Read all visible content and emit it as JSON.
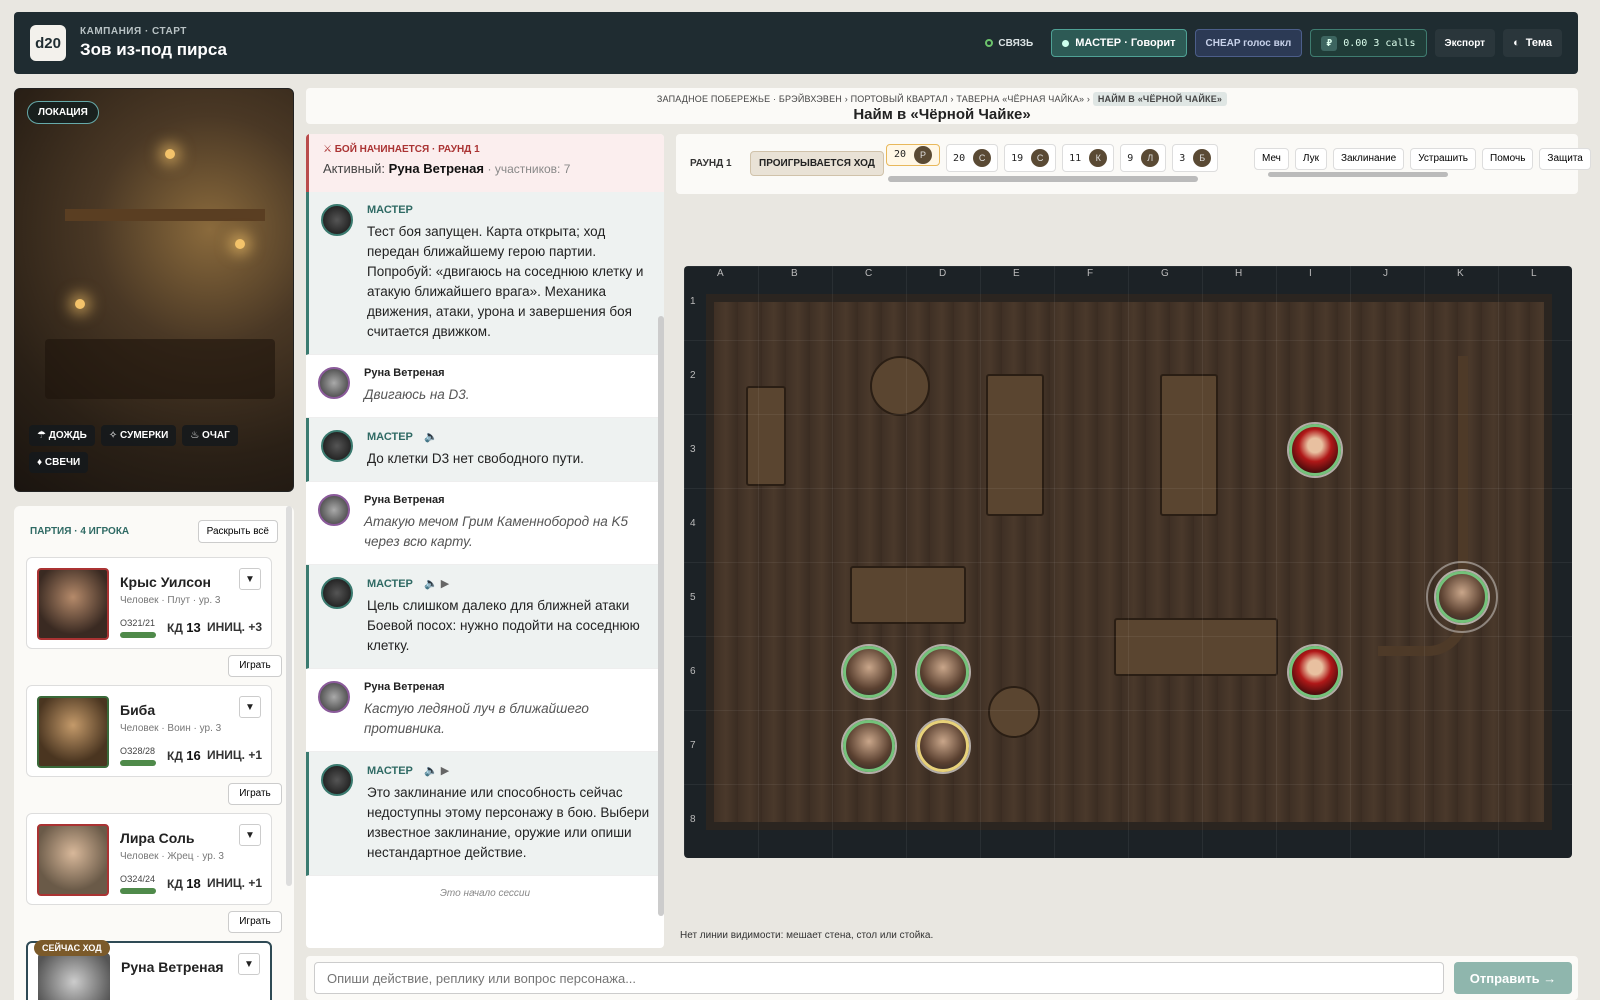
{
  "header": {
    "logo": "d20",
    "subtitle": "КАМПАНИЯ · СТАРТ",
    "title": "Зов из-под пирса",
    "conn": "СВЯЗЬ",
    "master": "МАСТЕР · Говорит",
    "cheap": "CHEAP голос вкл",
    "money_sym": "₽",
    "money": "0.00 3 calls",
    "export": "Экспорт",
    "theme": "Тема"
  },
  "location": {
    "badge": "ЛОКАЦИЯ",
    "tags": [
      "☂ ДОЖДЬ",
      "✧ СУМЕРКИ",
      "♨ ОЧАГ",
      "♦ СВЕЧИ"
    ]
  },
  "party": {
    "title": "ПАРТИЯ · 4 ИГРОКА",
    "expand": "Раскрыть всё",
    "play": "Играть",
    "now": "СЕЙЧАС ХОД",
    "members": [
      {
        "name": "Крыс Уилсон",
        "race": "Человек · Плут · ур. 3",
        "hp": "ОЗ21/21",
        "kd_label": "КД",
        "kd": "13",
        "ini_label": "ИНИЦ.",
        "ini": "+3"
      },
      {
        "name": "Биба",
        "race": "Человек · Воин · ур. 3",
        "hp": "ОЗ28/28",
        "kd_label": "КД",
        "kd": "16",
        "ini_label": "ИНИЦ.",
        "ini": "+1"
      },
      {
        "name": "Лира Соль",
        "race": "Человек · Жрец · ур. 3",
        "hp": "ОЗ24/24",
        "kd_label": "КД",
        "kd": "18",
        "ini_label": "ИНИЦ.",
        "ini": "+1"
      },
      {
        "name": "Руна Ветреная"
      }
    ]
  },
  "crumb": {
    "path": [
      "ЗАПАДНОЕ ПОБЕРЕЖЬЕ · БРЭЙВХЭВЕН",
      "ПОРТОВЫЙ КВАРТАЛ",
      "ТАВЕРНА «ЧЁРНАЯ ЧАЙКА»"
    ],
    "current": "НАЙМ В «ЧЁРНОЙ ЧАЙКЕ»",
    "title": "Найм в «Чёрной Чайке»"
  },
  "chat": {
    "battle_title": "⚔ БОЙ НАЧИНАЕТСЯ · РАУНД 1",
    "active_label": "Активный:",
    "active_name": "Руна Ветреная",
    "participants": "· участников: 7",
    "messages": [
      {
        "who": "МАСТЕР",
        "text": "Тест боя запущен. Карта открыта; ход передан ближайшему герою партии. Попробуй: «двигаюсь на соседнюю клетку и атакую ближайшего врага». Механика движения, атаки, урона и завершения боя считается движком."
      },
      {
        "who": "Руна Ветреная",
        "text": "Двигаюсь на D3."
      },
      {
        "who": "МАСТЕР",
        "text": "До клетки D3 нет свободного пути."
      },
      {
        "who": "Руна Ветреная",
        "text": "Атакую мечом Грим Каменнобород на K5 через всю карту."
      },
      {
        "who": "МАСТЕР",
        "text": "Цель слишком далеко для ближней атаки Боевой посох: нужно подойти на соседнюю клетку."
      },
      {
        "who": "Руна Ветреная",
        "text": "Кастую ледяной луч в ближайшего противника."
      },
      {
        "who": "МАСТЕР",
        "text": "Это заклинание или способность сейчас недоступны этому персонажу в бою. Выбери известное заклинание, оружие или опиши нестандартное действие."
      }
    ],
    "start": "Это начало сессии"
  },
  "combat": {
    "round": "РАУНД 1",
    "turn": "ПРОИГРЫВАЕТСЯ ХОД",
    "init": [
      {
        "n": "20",
        "c": "Р"
      },
      {
        "n": "20",
        "c": "С"
      },
      {
        "n": "19",
        "c": "С"
      },
      {
        "n": "11",
        "c": "К"
      },
      {
        "n": "9",
        "c": "Л"
      },
      {
        "n": "3",
        "c": "Б"
      }
    ],
    "actions": [
      "Меч",
      "Лук",
      "Заклинание",
      "Устрашить",
      "Помочь",
      "Защита"
    ]
  },
  "map": {
    "cols": [
      "A",
      "B",
      "C",
      "D",
      "E",
      "F",
      "G",
      "H",
      "I",
      "J",
      "K",
      "L"
    ],
    "rows": [
      "1",
      "2",
      "3",
      "4",
      "5",
      "6",
      "7",
      "8"
    ]
  },
  "los": "Нет линии видимости: мешает стена, стол или стойка.",
  "input": {
    "placeholder": "Опиши действие, реплику или вопрос персонажа...",
    "send": "Отправить →"
  }
}
